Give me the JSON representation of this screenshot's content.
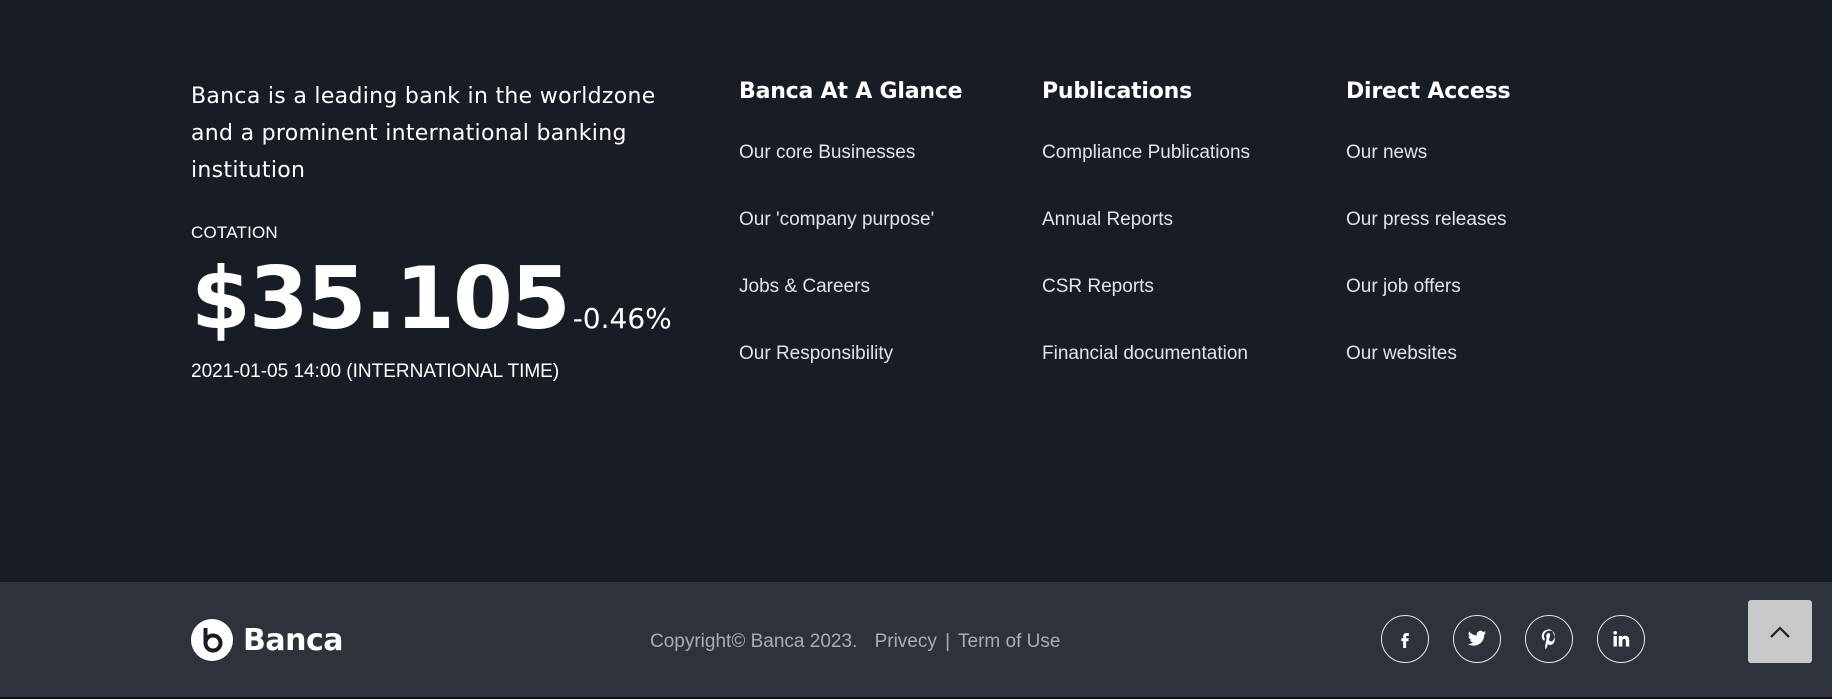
{
  "about": {
    "text": "Banca is a leading bank in the worldzone and a prominent international banking institution",
    "cotation_label": "COTATION",
    "price": "$35.105",
    "change": "-0.46%",
    "timestamp": "2021-01-05 14:00 (INTERNATIONAL TIME)"
  },
  "columns": [
    {
      "title": "Banca At A Glance",
      "links": [
        "Our core Businesses",
        "Our 'company purpose'",
        "Jobs & Careers",
        "Our Responsibility"
      ]
    },
    {
      "title": "Publications",
      "links": [
        "Compliance Publications",
        "Annual Reports",
        "CSR Reports",
        "Financial documentation"
      ]
    },
    {
      "title": "Direct Access",
      "links": [
        "Our news",
        "Our press releases",
        "Our job offers",
        "Our websites"
      ]
    }
  ],
  "bottom": {
    "brand_name": "Banca",
    "copyright": "Copyright© Banca 2023.",
    "privacy": "Privecy",
    "separator": "|",
    "terms": "Term of Use"
  },
  "social": [
    "facebook-icon",
    "twitter-icon",
    "pinterest-icon",
    "linkedin-icon"
  ],
  "colors": {
    "background": "#181d25",
    "bottom_bar": "#2e333b",
    "link_text": "#dfe3ea",
    "muted_text": "#a9aeb6",
    "scroll_top_button": "#c8c8c9"
  }
}
